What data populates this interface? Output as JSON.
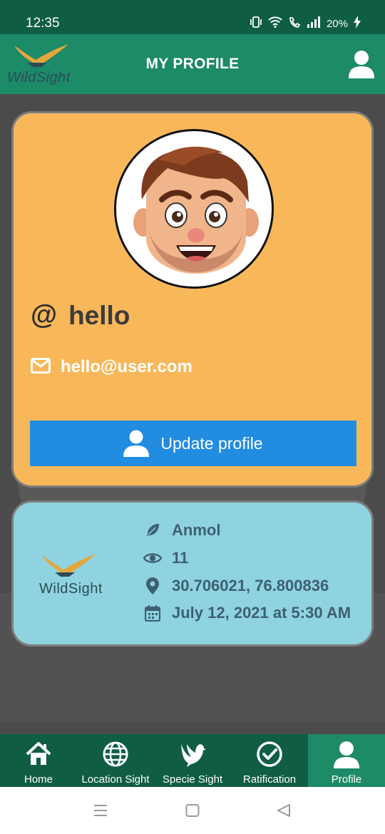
{
  "status": {
    "time": "12:35",
    "battery": "20%"
  },
  "header": {
    "title": "MY PROFILE",
    "logo_text": "WildSight"
  },
  "profile": {
    "username": "hello",
    "email": "hello@user.com",
    "update_label": "Update profile"
  },
  "sighting": {
    "logo_text": "WildSight",
    "name": "Anmol",
    "views": "11",
    "coordinates": "30.706021, 76.800836",
    "datetime": "July 12, 2021 at 5:30 AM"
  },
  "nav": {
    "items": [
      {
        "label": "Home",
        "icon": "home-icon"
      },
      {
        "label": "Location Sight",
        "icon": "globe-icon"
      },
      {
        "label": "Specie Sight",
        "icon": "bird-icon"
      },
      {
        "label": "Ratification",
        "icon": "check-circle-icon"
      },
      {
        "label": "Profile",
        "icon": "user-icon"
      }
    ],
    "active_index": 4
  },
  "colors": {
    "status_bar": "#0f5d44",
    "app_bar": "#1d8a68",
    "profile_card": "#f8b85a",
    "info_card": "#8fd3e0",
    "button": "#228ce0"
  }
}
